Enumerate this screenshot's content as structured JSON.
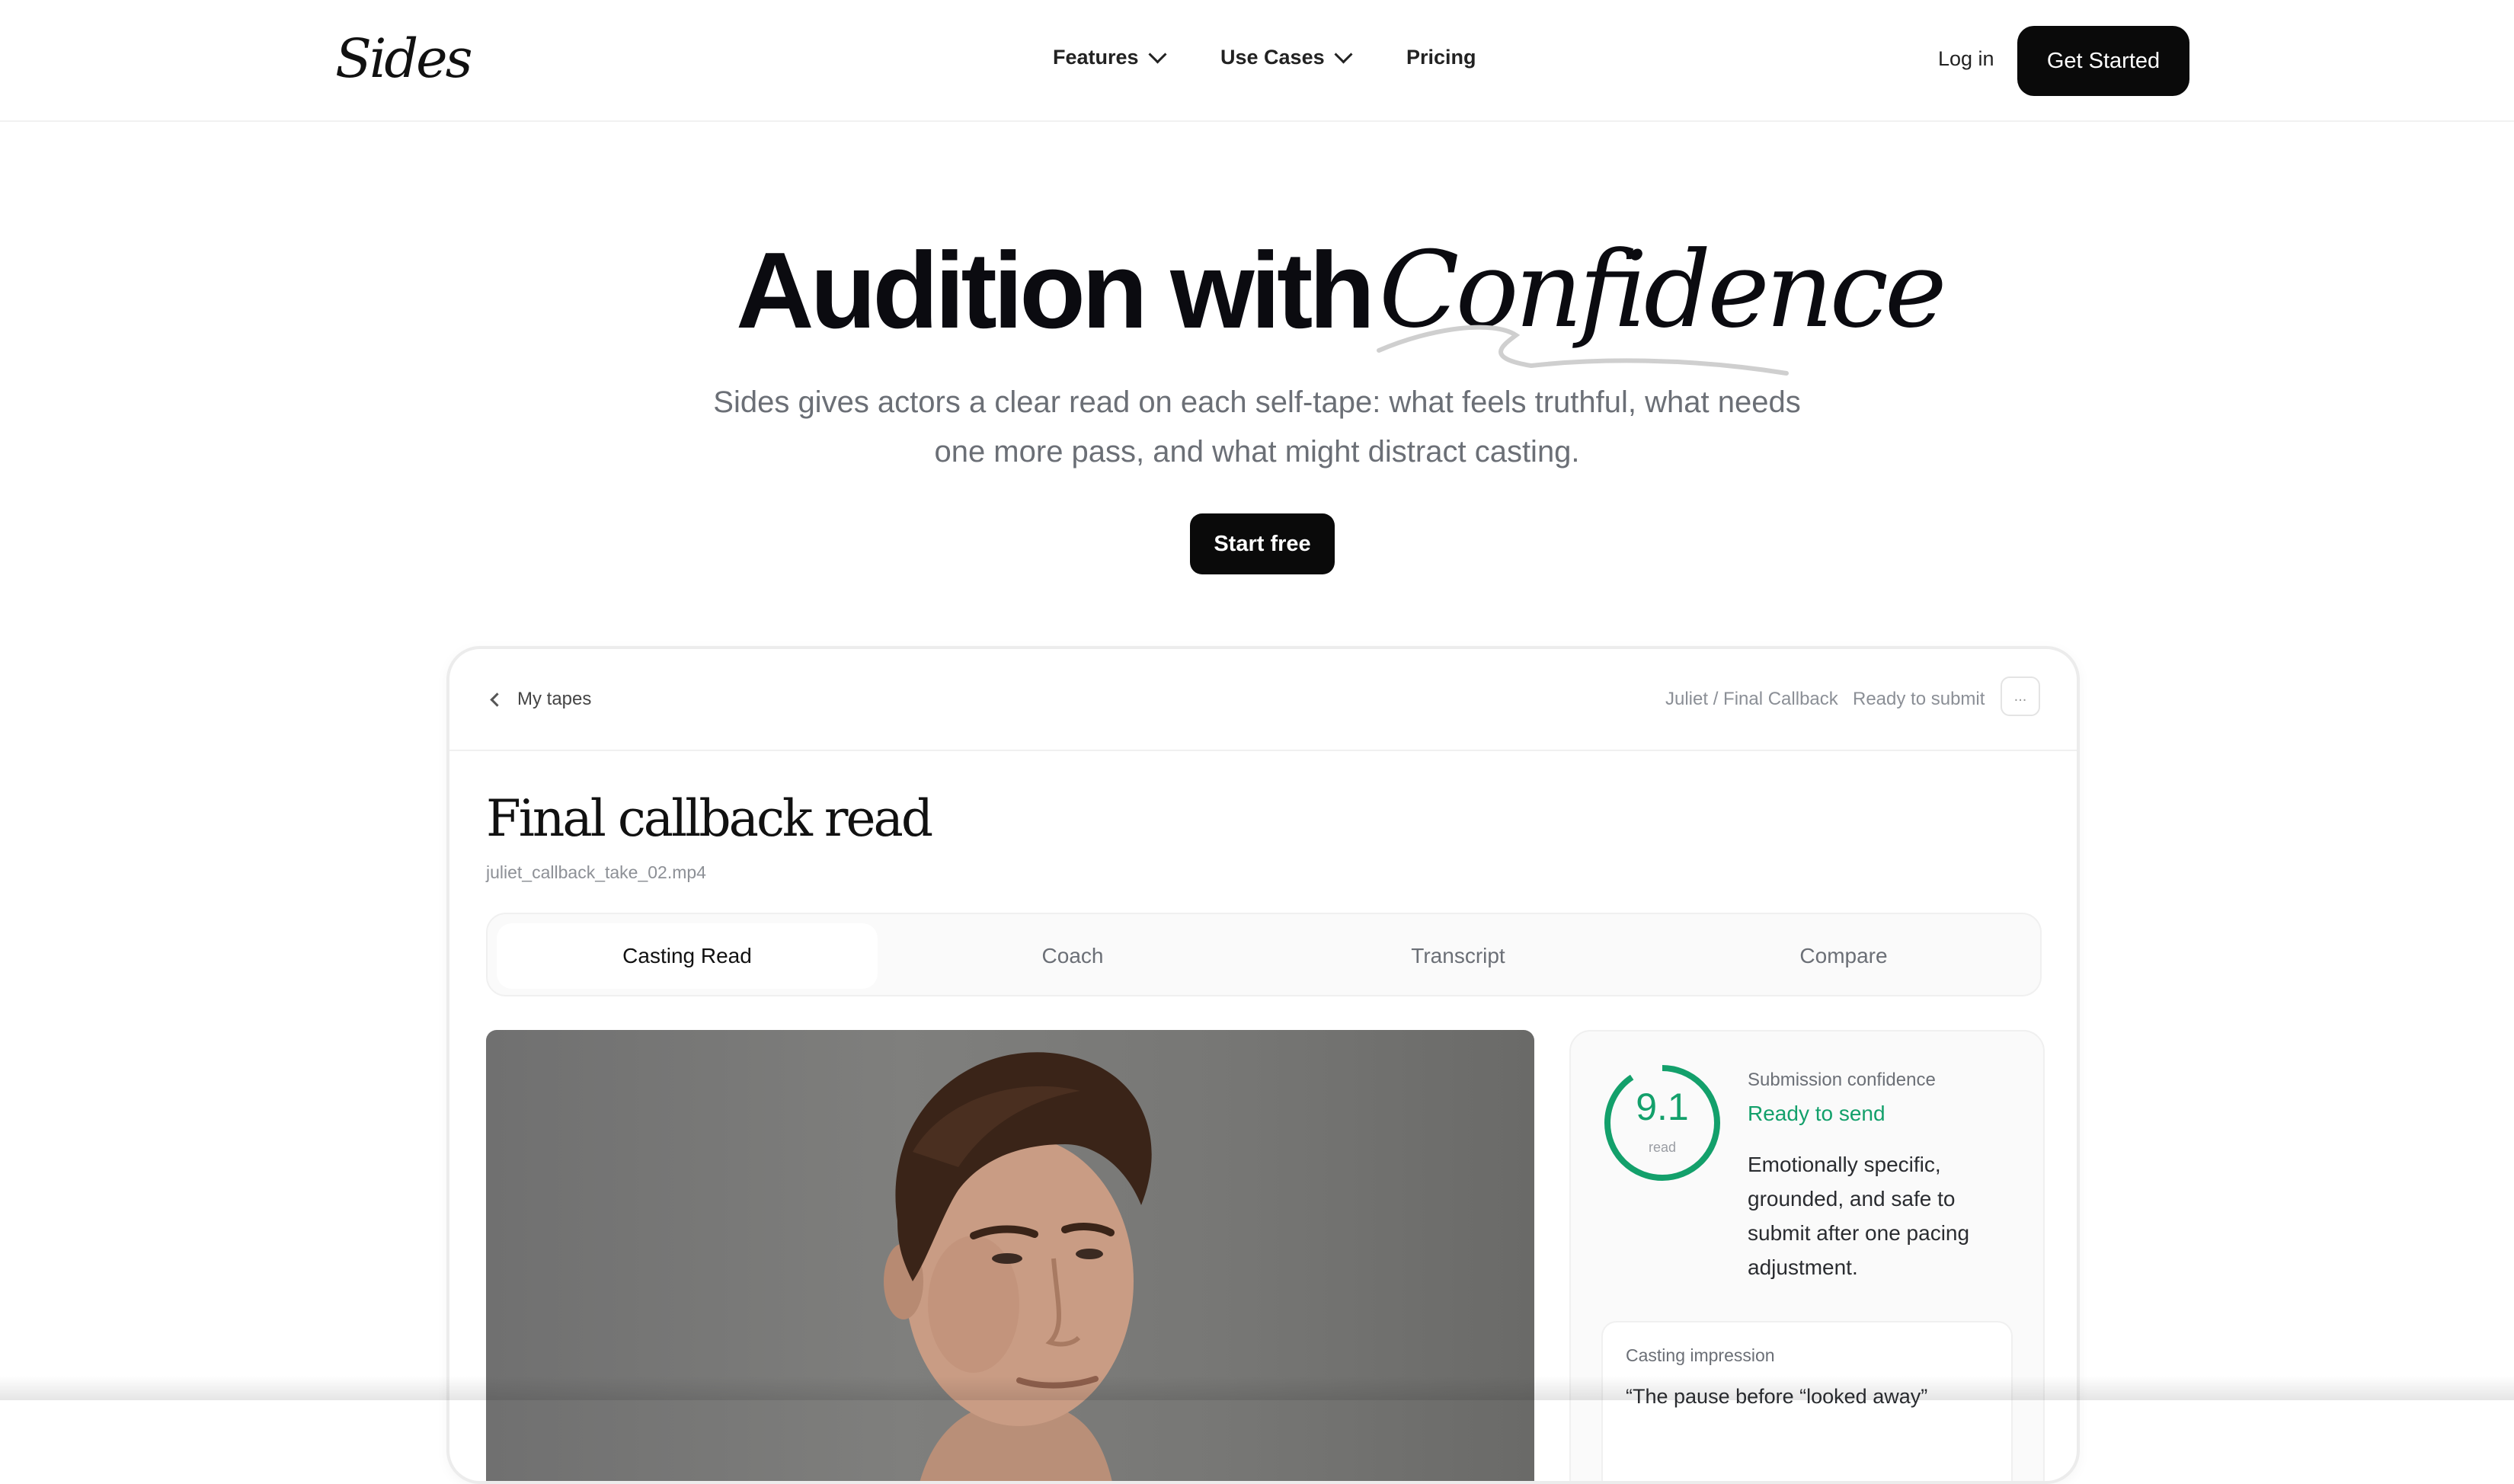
{
  "nav": {
    "logo": "Sides",
    "items": [
      {
        "label": "Features",
        "has_dropdown": true
      },
      {
        "label": "Use Cases",
        "has_dropdown": true
      },
      {
        "label": "Pricing",
        "has_dropdown": false
      }
    ],
    "login_label": "Log in",
    "cta_label": "Get Started"
  },
  "hero": {
    "title_plain": "Audition with",
    "title_script": "Confidence",
    "subtitle": "Sides gives actors a clear read on each self-tape: what feels truthful, what needs one more pass, and what might distract casting.",
    "cta_label": "Start free"
  },
  "app": {
    "back_label": "My tapes",
    "breadcrumb": "Juliet / Final Callback",
    "status": "Ready to submit",
    "more_label": "...",
    "title": "Final callback read",
    "filename": "juliet_callback_take_02.mp4",
    "tabs": [
      {
        "label": "Casting Read",
        "active": true
      },
      {
        "label": "Coach",
        "active": false
      },
      {
        "label": "Transcript",
        "active": false
      },
      {
        "label": "Compare",
        "active": false
      }
    ],
    "confidence": {
      "score": "9.1",
      "score_unit": "read",
      "label": "Submission confidence",
      "value": "Ready to send",
      "description": "Emotionally specific, grounded, and safe to submit after one pacing adjustment.",
      "accent_color": "#13a06b"
    },
    "impression": {
      "label": "Casting impression",
      "quote": "“The pause before “looked away”"
    }
  }
}
